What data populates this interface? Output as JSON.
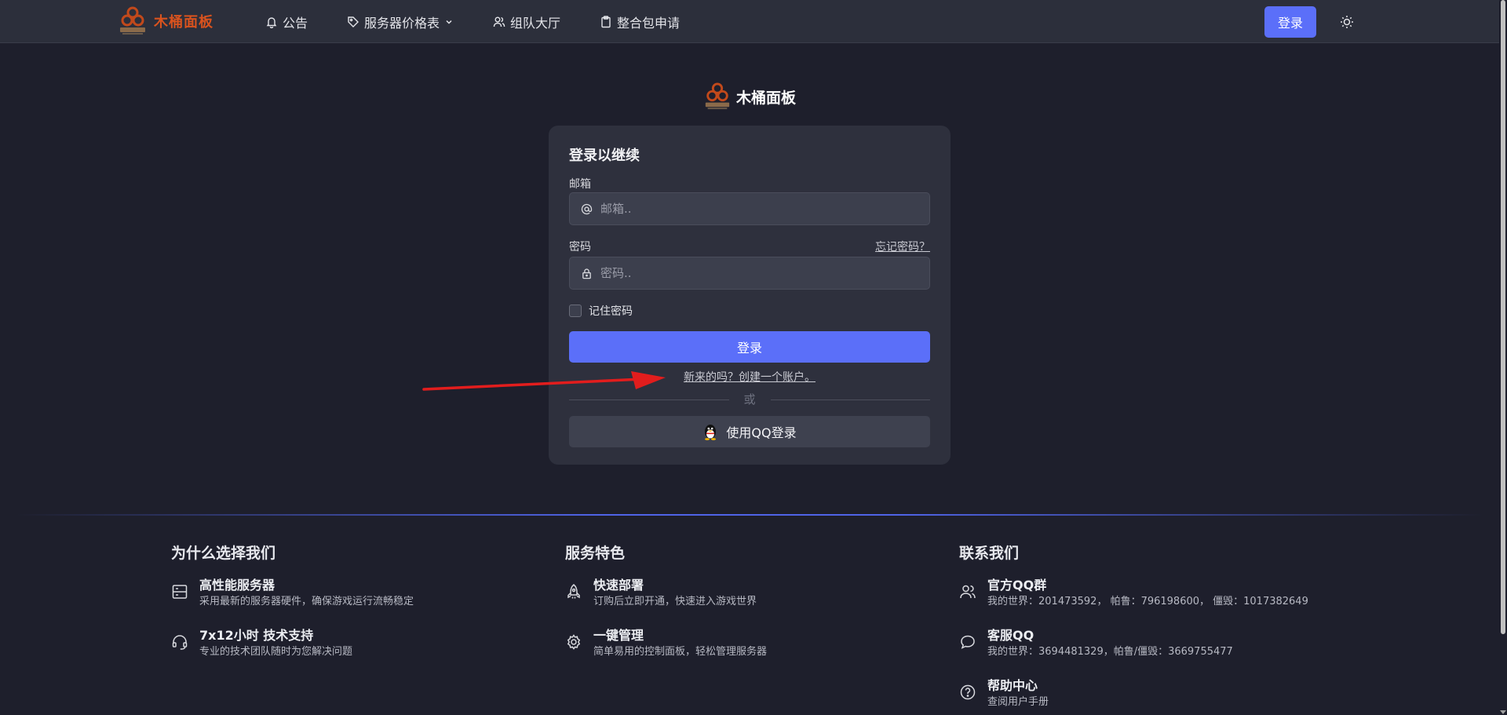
{
  "nav": {
    "brand_name": "木桶面板",
    "links": [
      {
        "label": "公告",
        "icon": "bell-icon"
      },
      {
        "label": "服务器价格表",
        "icon": "tag-icon"
      },
      {
        "label": "组队大厅",
        "icon": "users-icon"
      },
      {
        "label": "整合包申请",
        "icon": "clipboard-icon"
      }
    ],
    "login_label": "登录"
  },
  "center_brand": {
    "name": "木桶面板"
  },
  "login": {
    "title": "登录以继续",
    "email_label": "邮箱",
    "email_placeholder": "邮箱..",
    "password_label": "密码",
    "forgot_label": "忘记密码？",
    "password_placeholder": "密码..",
    "remember_label": "记住密码",
    "submit_label": "登录",
    "register_label": "新来的吗？创建一个账户。",
    "divider_label": "或",
    "qq_login_label": "使用QQ登录"
  },
  "footer": {
    "why": {
      "heading": "为什么选择我们",
      "items": [
        {
          "title": "高性能服务器",
          "desc": "采用最新的服务器硬件，确保游戏运行流畅稳定"
        },
        {
          "title": "7x12小时 技术支持",
          "desc": "专业的技术团队随时为您解决问题"
        }
      ]
    },
    "features": {
      "heading": "服务特色",
      "items": [
        {
          "title": "快速部署",
          "desc": "订购后立即开通，快速进入游戏世界"
        },
        {
          "title": "一键管理",
          "desc": "简单易用的控制面板，轻松管理服务器"
        }
      ]
    },
    "contact": {
      "heading": "联系我们",
      "items": [
        {
          "title": "官方QQ群",
          "desc": "我的世界：201473592， 帕鲁：796198600， 僵毁：1017382649"
        },
        {
          "title": "客服QQ",
          "desc": "我的世界：3694481329，帕鲁/僵毁：3669755477"
        },
        {
          "title": "帮助中心",
          "desc": "查阅用户手册"
        }
      ]
    }
  },
  "colors": {
    "accent": "#5b6ff9",
    "brand": "#d9531e",
    "background": "#1e1f2c",
    "card": "#2e303d"
  }
}
